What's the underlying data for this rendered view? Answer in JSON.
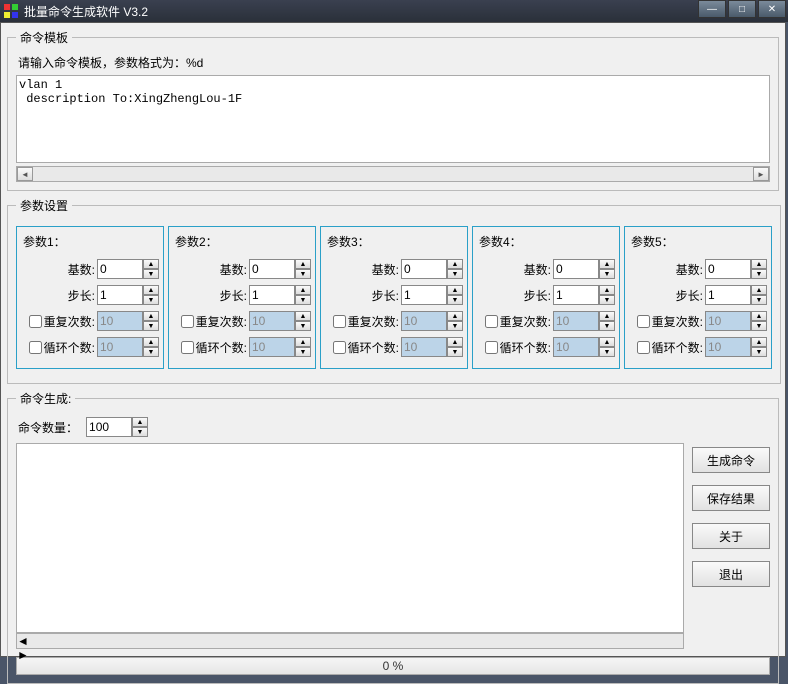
{
  "window": {
    "title": "批量命令生成软件 V3.2"
  },
  "template_group": {
    "legend": "命令模板",
    "hint": "请输入命令模板，参数格式为：%d",
    "content": "vlan 1\n description To:XingZhengLou-1F"
  },
  "params_group": {
    "legend": "参数设置",
    "labels": {
      "base": "基数:",
      "step": "步长:",
      "repeat": "重复次数:",
      "loop": "循环个数:"
    },
    "items": [
      {
        "title": "参数1：",
        "base": "0",
        "step": "1",
        "repeat": "10",
        "loop": "10",
        "repeat_checked": false,
        "loop_checked": false
      },
      {
        "title": "参数2：",
        "base": "0",
        "step": "1",
        "repeat": "10",
        "loop": "10",
        "repeat_checked": false,
        "loop_checked": false
      },
      {
        "title": "参数3：",
        "base": "0",
        "step": "1",
        "repeat": "10",
        "loop": "10",
        "repeat_checked": false,
        "loop_checked": false
      },
      {
        "title": "参数4：",
        "base": "0",
        "step": "1",
        "repeat": "10",
        "loop": "10",
        "repeat_checked": false,
        "loop_checked": false
      },
      {
        "title": "参数5：",
        "base": "0",
        "step": "1",
        "repeat": "10",
        "loop": "10",
        "repeat_checked": false,
        "loop_checked": false
      }
    ]
  },
  "generate_group": {
    "legend": "命令生成:",
    "count_label": "命令数量：",
    "count_value": "100",
    "buttons": {
      "generate": "生成命令",
      "save": "保存结果",
      "about": "关于",
      "exit": "退出"
    },
    "progress_text": "0 %"
  }
}
